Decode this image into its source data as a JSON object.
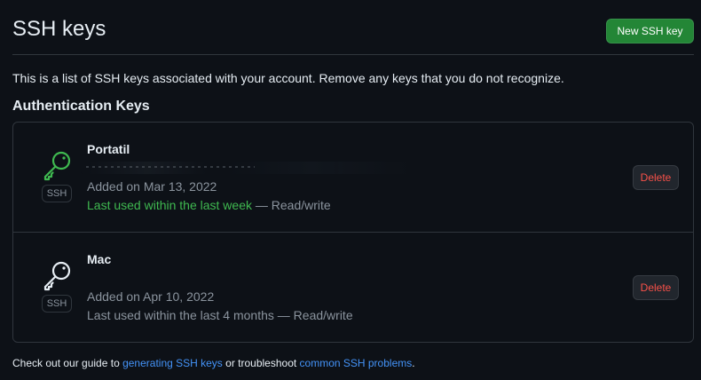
{
  "header": {
    "title": "SSH keys",
    "new_key_button": "New SSH key"
  },
  "intro_text": "This is a list of SSH keys associated with your account. Remove any keys that you do not recognize.",
  "section_heading": "Authentication Keys",
  "keys": [
    {
      "title": "Portatil",
      "badge": "SSH",
      "added": "Added on Mar 13, 2022",
      "last_used": "Last used within the last week",
      "access": " — Read/write",
      "delete_label": "Delete",
      "icon": "key-icon",
      "icon_color": "#3fb950"
    },
    {
      "title": "Mac",
      "badge": "SSH",
      "added": "Added on Apr 10, 2022",
      "last_used": "Last used within the last 4 months",
      "access": " — Read/write",
      "delete_label": "Delete",
      "icon": "key-icon",
      "icon_color": "#e6edf3"
    }
  ],
  "footer": {
    "prefix": "Check out our guide to ",
    "link_generating": "generating SSH keys",
    "middle": " or troubleshoot ",
    "link_problems": "common SSH problems",
    "suffix": "."
  },
  "colors": {
    "background": "#0d1117",
    "border": "#30363d",
    "primary_button": "#238636",
    "danger": "#f85149",
    "link": "#4493f8",
    "recent_activity": "#3fb950"
  }
}
